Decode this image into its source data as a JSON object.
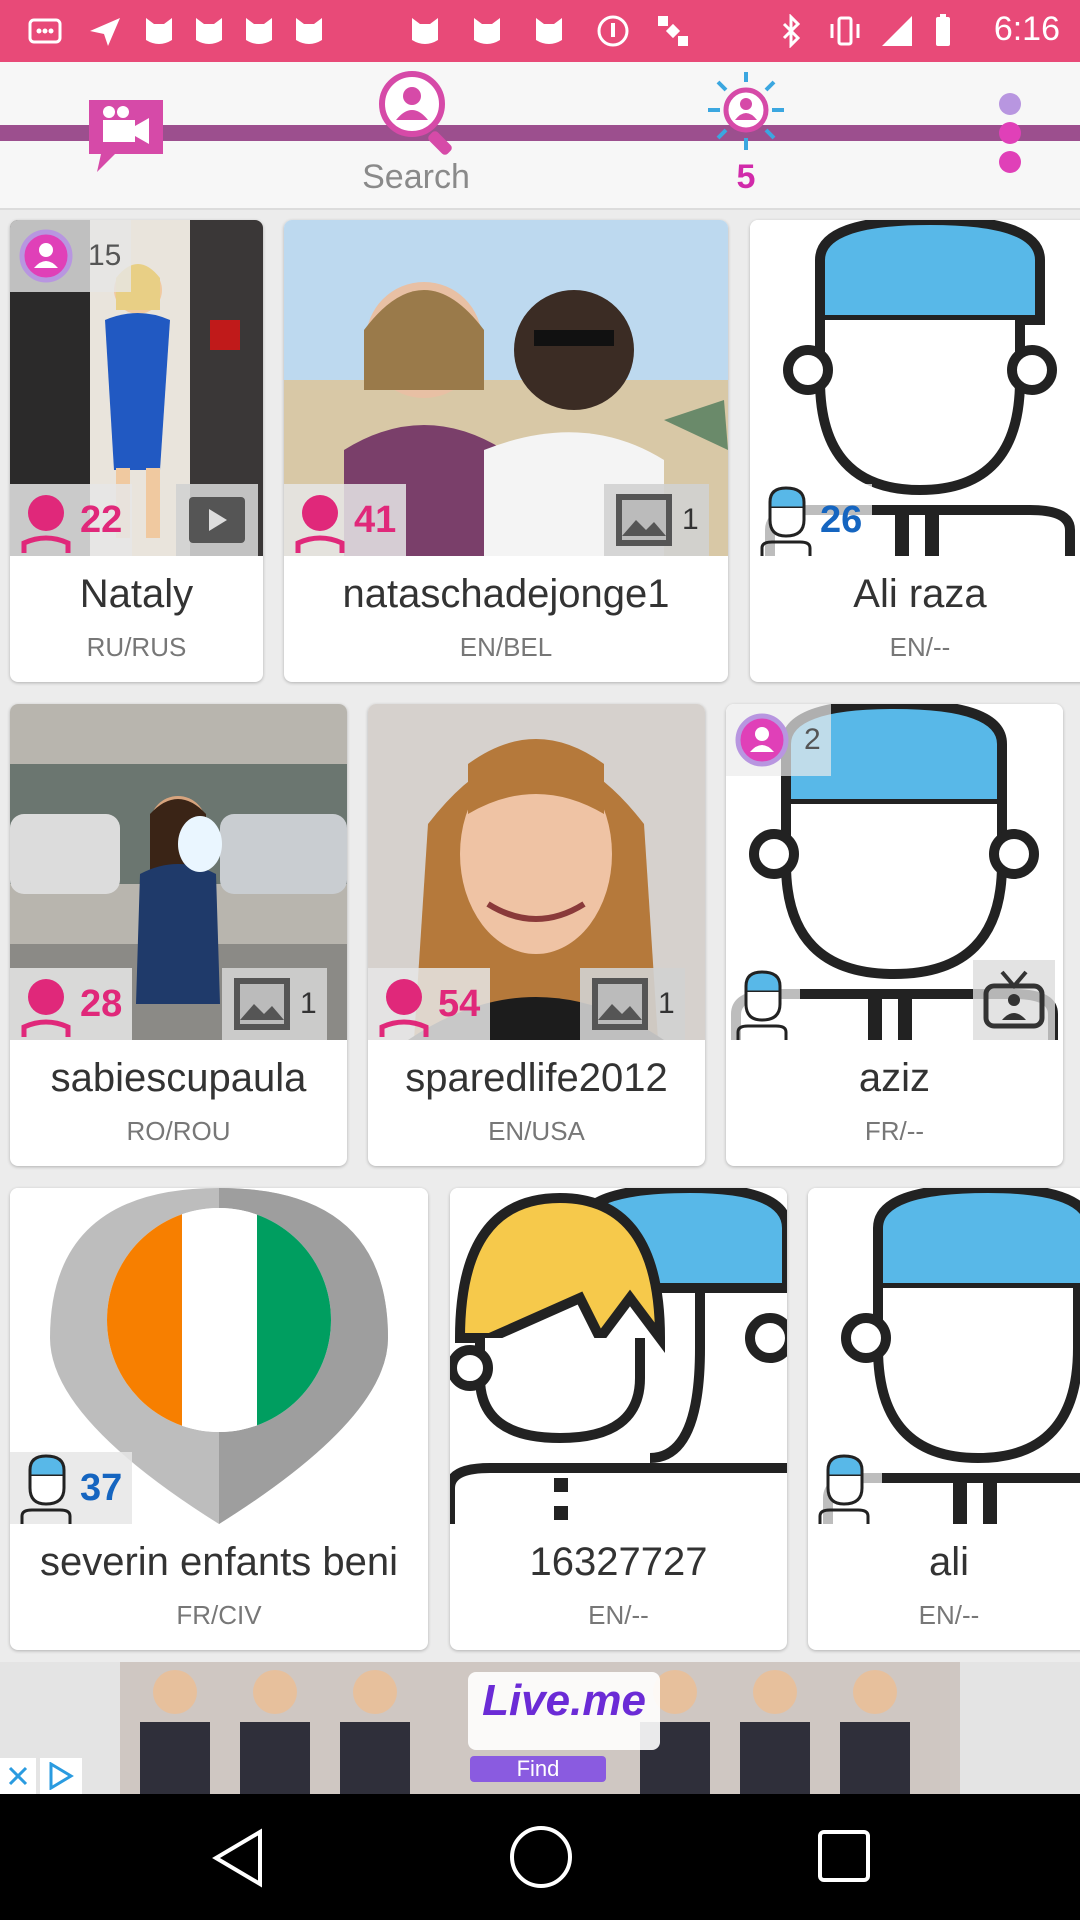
{
  "status_bar": {
    "time": "6:16",
    "icons": [
      "apps-icon",
      "send-icon",
      "cat-face-icon",
      "cat-face-icon",
      "cat-face-icon",
      "cat-face-icon",
      "cat-face-icon",
      "cat-face-icon",
      "info-icon",
      "satellite-icon",
      "bluetooth-icon",
      "vibrate-icon",
      "signal-icon",
      "battery-icon"
    ]
  },
  "nav": {
    "search_label": "Search",
    "nearby_count": "5"
  },
  "cards": [
    {
      "name": "Nataly",
      "locale": "RU/RUS",
      "age": "22",
      "gender": "female",
      "vip_count": "15",
      "photo_count": ""
    },
    {
      "name": "nataschadejonge1",
      "locale": "EN/BEL",
      "age": "41",
      "gender": "female",
      "vip_count": "",
      "photo_count": "1"
    },
    {
      "name": "Ali raza",
      "locale": "EN/--",
      "age": "26",
      "gender": "male",
      "vip_count": "",
      "photo_count": ""
    },
    {
      "name": "sabiescupaula",
      "locale": "RO/ROU",
      "age": "28",
      "gender": "female",
      "vip_count": "",
      "photo_count": "1"
    },
    {
      "name": "sparedlife2012",
      "locale": "EN/USA",
      "age": "54",
      "gender": "female",
      "vip_count": "",
      "photo_count": "1"
    },
    {
      "name": "aziz",
      "locale": "FR/--",
      "age": "",
      "gender": "male",
      "vip_count": "2",
      "photo_count": ""
    },
    {
      "name": "severin enfants beni",
      "locale": "FR/CIV",
      "age": "37",
      "gender": "male",
      "vip_count": "",
      "photo_count": ""
    },
    {
      "name": "16327727",
      "locale": "EN/--",
      "age": "",
      "gender": "couple",
      "vip_count": "",
      "photo_count": ""
    },
    {
      "name": "ali",
      "locale": "EN/--",
      "age": "",
      "gender": "male",
      "vip_count": "",
      "photo_count": ""
    }
  ],
  "ad": {
    "brand": "Live.me",
    "button": "Find"
  },
  "colors": {
    "accent": "#e84a78",
    "female": "#e0287a",
    "male": "#1565c0",
    "nav_line": "#9c4f8e"
  }
}
